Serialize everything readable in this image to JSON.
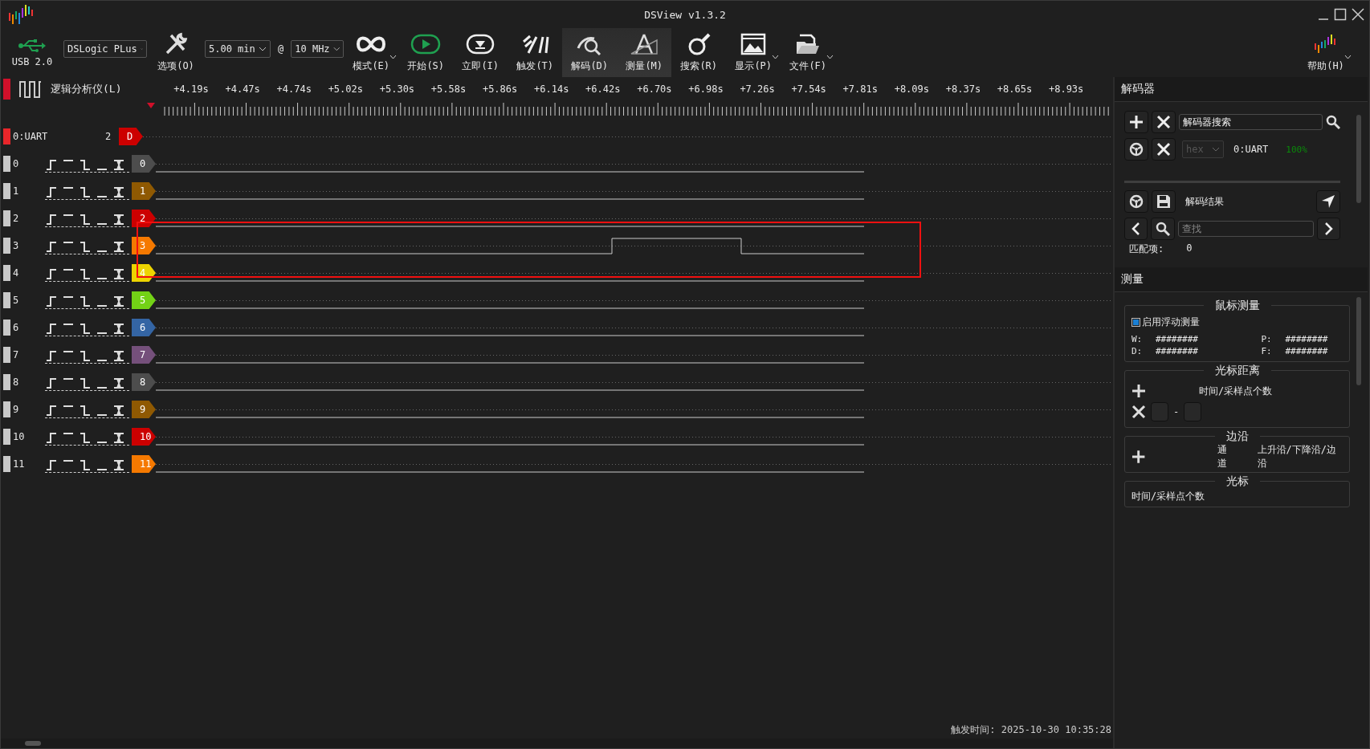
{
  "window": {
    "title": "DSView v1.3.2"
  },
  "toolbar": {
    "usb": {
      "label": "USB 2.0"
    },
    "device": {
      "value": "DSLogic PLus"
    },
    "options": {
      "label": "选项(O)"
    },
    "duration": {
      "value": "5.00 min"
    },
    "at": "@",
    "rate": {
      "value": "10 MHz"
    },
    "buttons": [
      {
        "kind": "mode",
        "label": "模式(E)",
        "dropdown": true,
        "selected": false
      },
      {
        "kind": "start",
        "label": "开始(S)",
        "dropdown": false,
        "selected": false
      },
      {
        "kind": "instant",
        "label": "立即(I)",
        "dropdown": false,
        "selected": false
      },
      {
        "kind": "trigger",
        "label": "触发(T)",
        "dropdown": false,
        "selected": false
      },
      {
        "kind": "decode",
        "label": "解码(D)",
        "dropdown": false,
        "selected": true
      },
      {
        "kind": "measure",
        "label": "测量(M)",
        "dropdown": false,
        "selected": true
      },
      {
        "kind": "search",
        "label": "搜索(R)",
        "dropdown": false,
        "selected": false
      },
      {
        "kind": "display",
        "label": "显示(P)",
        "dropdown": true,
        "selected": false
      },
      {
        "kind": "file",
        "label": "文件(F)",
        "dropdown": true,
        "selected": false
      }
    ],
    "help": {
      "label": "帮助(H)",
      "dropdown": true
    }
  },
  "view": {
    "title": "逻辑分析仪(L)",
    "ruler": [
      "+4.19s",
      "+4.47s",
      "+4.74s",
      "+5.02s",
      "+5.30s",
      "+5.58s",
      "+5.86s",
      "+6.14s",
      "+6.42s",
      "+6.70s",
      "+6.98s",
      "+7.26s",
      "+7.54s",
      "+7.81s",
      "+8.09s",
      "+8.37s",
      "+8.65s",
      "+8.93s"
    ],
    "decoders": [
      {
        "label": "0:UART",
        "count": "2",
        "tag": "D",
        "color": "#cc0000"
      }
    ],
    "channels": [
      {
        "label": "0",
        "tag": "0",
        "color": "#4d4d4d",
        "kind": "low"
      },
      {
        "label": "1",
        "tag": "1",
        "color": "#8f5902",
        "kind": "low"
      },
      {
        "label": "2",
        "tag": "2",
        "color": "#cc0000",
        "kind": "low"
      },
      {
        "label": "3",
        "tag": "3",
        "color": "#f57900",
        "kind": "pulse"
      },
      {
        "label": "4",
        "tag": "4",
        "color": "#edd400",
        "kind": "low"
      },
      {
        "label": "5",
        "tag": "5",
        "color": "#73d216",
        "kind": "low"
      },
      {
        "label": "6",
        "tag": "6",
        "color": "#3465a4",
        "kind": "low"
      },
      {
        "label": "7",
        "tag": "7",
        "color": "#75507b",
        "kind": "low"
      },
      {
        "label": "8",
        "tag": "8",
        "color": "#4d4d4d",
        "kind": "low"
      },
      {
        "label": "9",
        "tag": "9",
        "color": "#8f5902",
        "kind": "low"
      },
      {
        "label": "10",
        "tag": "10",
        "color": "#cc0000",
        "kind": "low"
      },
      {
        "label": "11",
        "tag": "11",
        "color": "#f57900",
        "kind": "low"
      }
    ]
  },
  "status": {
    "label": "触发时间:",
    "value": "2025-10-30 10:35:28"
  },
  "decoder_panel": {
    "title": "解码器",
    "search": {
      "value": "解码器搜索"
    },
    "decoders": [
      {
        "format": "hex",
        "disabled": true,
        "name": "0:UART",
        "progress": "100%",
        "done": true
      }
    ],
    "results": {
      "title": "解码结果",
      "search": {
        "placeholder": "查找"
      },
      "matches_label": "匹配项:",
      "matches": "0"
    }
  },
  "measure_panel": {
    "title": "测量",
    "mouse": {
      "title": "鼠标测量",
      "float": {
        "label": "启用浮动测量",
        "checked": true
      },
      "fields": [
        {
          "label": "W:",
          "value": "########"
        },
        {
          "label": "P:",
          "value": "########"
        },
        {
          "label": "D:",
          "value": "########"
        },
        {
          "label": "F:",
          "value": "########"
        }
      ]
    },
    "cursor_distance": {
      "title": "光标距离",
      "header": "时间/采样点个数",
      "separator": "-"
    },
    "edges": {
      "title": "边沿",
      "channel": "通道",
      "edge": "上升沿/下降沿/边沿"
    },
    "cursor": {
      "title": "光标",
      "header": "时间/采样点个数"
    }
  }
}
